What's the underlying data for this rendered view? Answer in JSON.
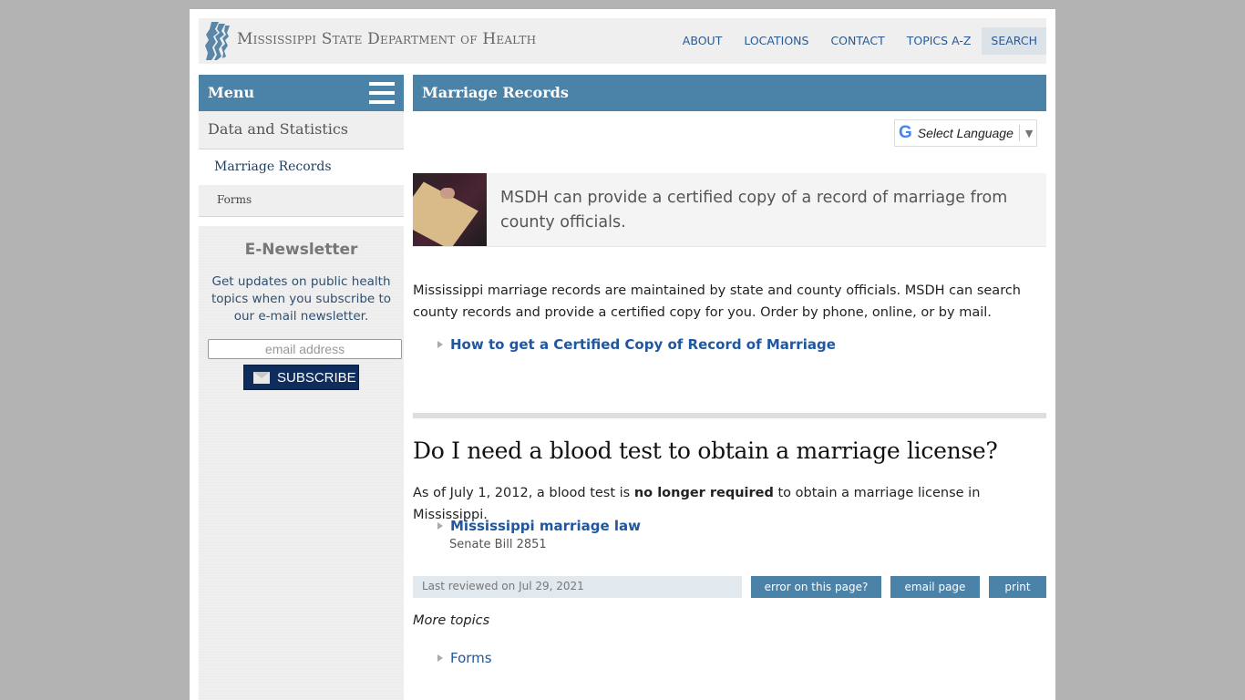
{
  "header": {
    "site_title": "Mississippi State Department of Health",
    "logo_icon": "msdh-profile-logo-icon",
    "nav": [
      {
        "label": "ABOUT"
      },
      {
        "label": "LOCATIONS"
      },
      {
        "label": "CONTACT"
      },
      {
        "label": "TOPICS A-Z"
      },
      {
        "label": "SEARCH"
      }
    ]
  },
  "sidebar": {
    "menu_label": "Menu",
    "menu_icon": "hamburger-icon",
    "items": [
      {
        "label": "Data and Statistics"
      },
      {
        "label": "Marriage Records"
      },
      {
        "label": "Forms"
      }
    ],
    "newsletter": {
      "title": "E-Newsletter",
      "text": "Get updates on public health topics when you subscribe to our e-mail newsletter.",
      "email_placeholder": "email address",
      "subscribe_label": "SUBSCRIBE",
      "subscribe_icon": "envelope-icon"
    }
  },
  "main": {
    "title": "Marriage Records",
    "language_select": {
      "label": "Select Language",
      "icon": "google-g-icon"
    },
    "intro_text": "MSDH can provide a certified copy of a record of marriage from county officials.",
    "paragraph": "Mississippi marriage records are maintained by state and county officials. MSDH can search county records and provide a certified copy for you. Order by phone, online, or by mail.",
    "link_certified_copy": "How to get a Certified Copy of Record of Marriage",
    "question_heading": "Do I need a blood test to obtain a marriage license?",
    "blood_test_text": {
      "before": "As of July 1, 2012, a blood test is ",
      "bold": "no longer required",
      "after": " to obtain a marriage license in Mississippi."
    },
    "link_marriage_law": "Mississippi marriage law",
    "link_marriage_law_sub": "Senate Bill 2851",
    "last_reviewed": "Last reviewed on Jul 29, 2021",
    "actions": {
      "error": "error on this page?",
      "email": "email page",
      "print": "print"
    },
    "more_topics_label": "More topics",
    "more_topics": [
      {
        "label": "Forms"
      }
    ]
  },
  "colors": {
    "accent_blue": "#4b82a8",
    "link_blue": "#1f57a0",
    "subscribe_navy": "#0e2c5c"
  }
}
